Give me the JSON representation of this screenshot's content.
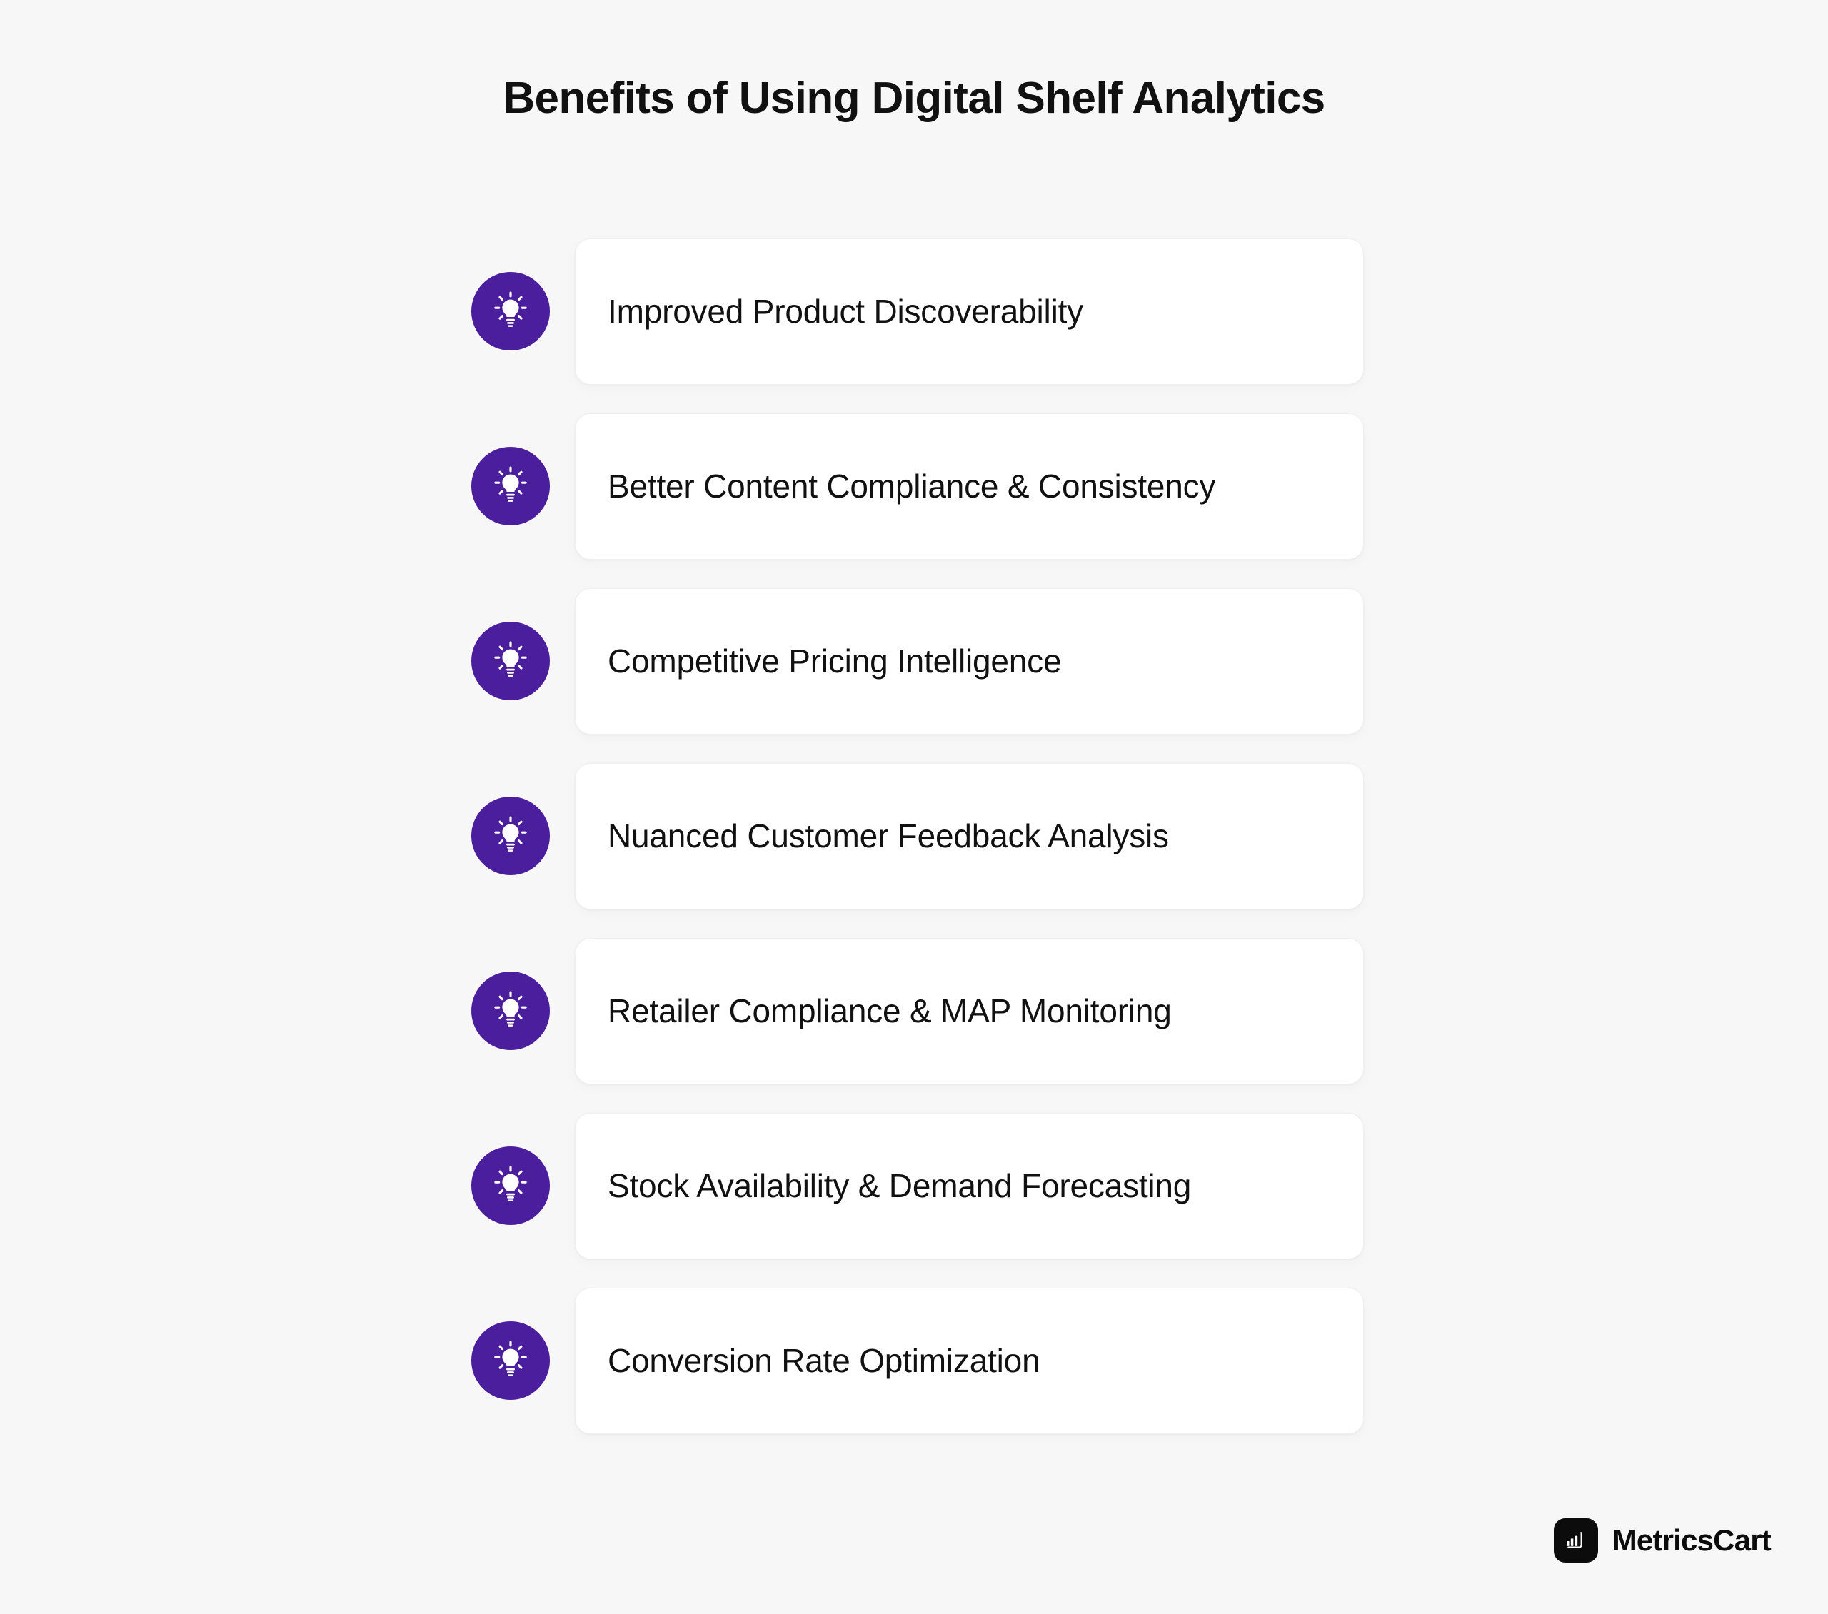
{
  "page": {
    "title": "Benefits of Using Digital Shelf Analytics",
    "background_color": "#F7F7F7",
    "accent_color": "#4B1E9E",
    "card_color": "#FFFFFF",
    "text_color": "#111111"
  },
  "benefits": [
    {
      "label": "Improved Product Discoverability",
      "icon": "lightbulb-icon"
    },
    {
      "label": "Better Content Compliance & Consistency",
      "icon": "lightbulb-icon"
    },
    {
      "label": "Competitive Pricing Intelligence",
      "icon": "lightbulb-icon"
    },
    {
      "label": "Nuanced Customer Feedback Analysis",
      "icon": "lightbulb-icon"
    },
    {
      "label": "Retailer Compliance & MAP Monitoring",
      "icon": "lightbulb-icon"
    },
    {
      "label": "Stock Availability & Demand Forecasting",
      "icon": "lightbulb-icon"
    },
    {
      "label": "Conversion Rate Optimization",
      "icon": "lightbulb-icon"
    }
  ],
  "brand": {
    "name": "MetricsCart",
    "icon": "chart-cart-logo-icon",
    "mark_color": "#0C0C0C"
  }
}
